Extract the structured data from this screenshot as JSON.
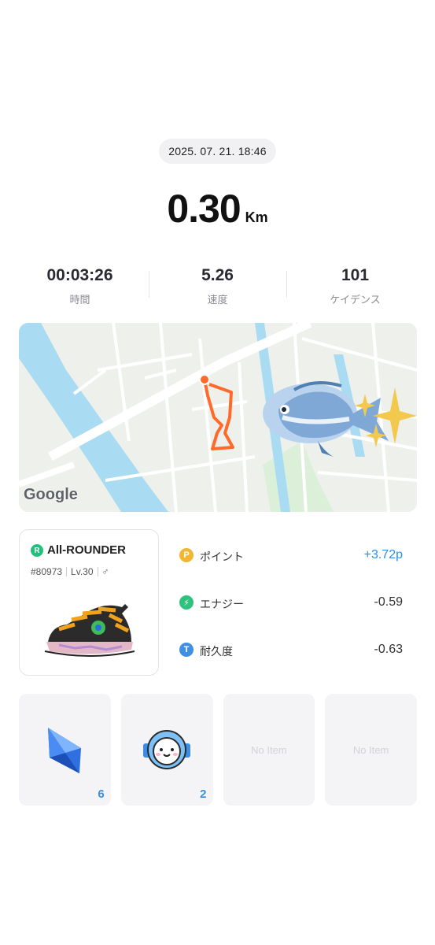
{
  "header": {
    "datetime": "2025. 07. 21. 18:46",
    "distance": "0.30",
    "distance_unit": "Km"
  },
  "stats": [
    {
      "value": "00:03:26",
      "label": "時間"
    },
    {
      "value": "5.26",
      "label": "速度"
    },
    {
      "value": "101",
      "label": "ケイデンス"
    }
  ],
  "map": {
    "attribution": "Google",
    "route_color": "#ff6a2b"
  },
  "shoe": {
    "badge": "R",
    "type": "All-ROUNDER",
    "id": "#80973",
    "level": "Lv.30",
    "gender_icon": "male-symbol-icon",
    "gender_symbol": "♂"
  },
  "rewards": [
    {
      "icon": "P",
      "icon_name": "point-coin-icon",
      "color": "#f2b632",
      "label": "ポイント",
      "value": "+3.72p"
    },
    {
      "icon": "⚡",
      "icon_name": "energy-bolt-icon",
      "color": "#2ec27e",
      "label": "エナジー",
      "value": "-0.59"
    },
    {
      "icon": "T",
      "icon_name": "durability-icon",
      "color": "#3f8fe3",
      "label": "耐久度",
      "value": "-0.63"
    }
  ],
  "items": [
    {
      "name": "blue-crystal",
      "count": "6"
    },
    {
      "name": "astronaut-mascot",
      "count": "2"
    },
    {
      "empty_label": "No Item"
    },
    {
      "empty_label": "No Item"
    }
  ]
}
